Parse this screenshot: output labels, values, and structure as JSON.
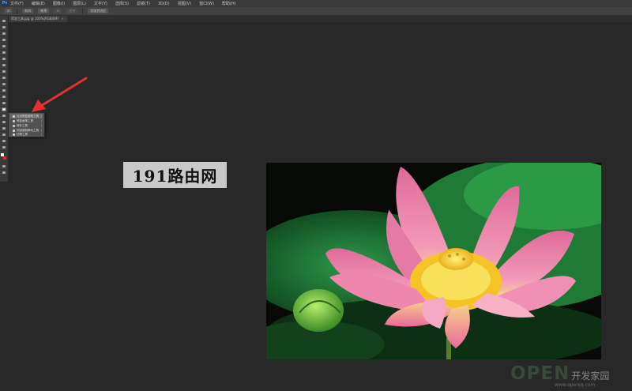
{
  "app": {
    "logo": "Ps",
    "menus": [
      "文件(F)",
      "编辑(E)",
      "图像(I)",
      "图层(L)",
      "文字(Y)",
      "选择(S)",
      "滤镜(T)",
      "3D(D)",
      "视图(V)",
      "窗口(W)",
      "帮助(H)"
    ]
  },
  "options": {
    "items": [
      "⊡",
      "取样",
      "新建",
      "从",
      "交叉",
      "添加到选区"
    ]
  },
  "document": {
    "tab_label": "荷花工具.jpg @ 100%(RGB/8#)",
    "close": "×"
  },
  "flyout": {
    "items": [
      {
        "label": "污点修复画笔工具",
        "shortcut": "J"
      },
      {
        "label": "修复画笔工具",
        "shortcut": "J"
      },
      {
        "label": "修补工具",
        "shortcut": "J"
      },
      {
        "label": "内容感知移动工具",
        "shortcut": "J"
      },
      {
        "label": "红眼工具",
        "shortcut": "J"
      }
    ]
  },
  "watermark": {
    "text": "191路由网",
    "open_word": "OPEN",
    "open_sub": "开发家园",
    "open_url": "www.openjq.com"
  },
  "colors": {
    "arrow": "#e53030",
    "foreground_swatch": "#ffffff",
    "background_swatch": "#d62828"
  }
}
